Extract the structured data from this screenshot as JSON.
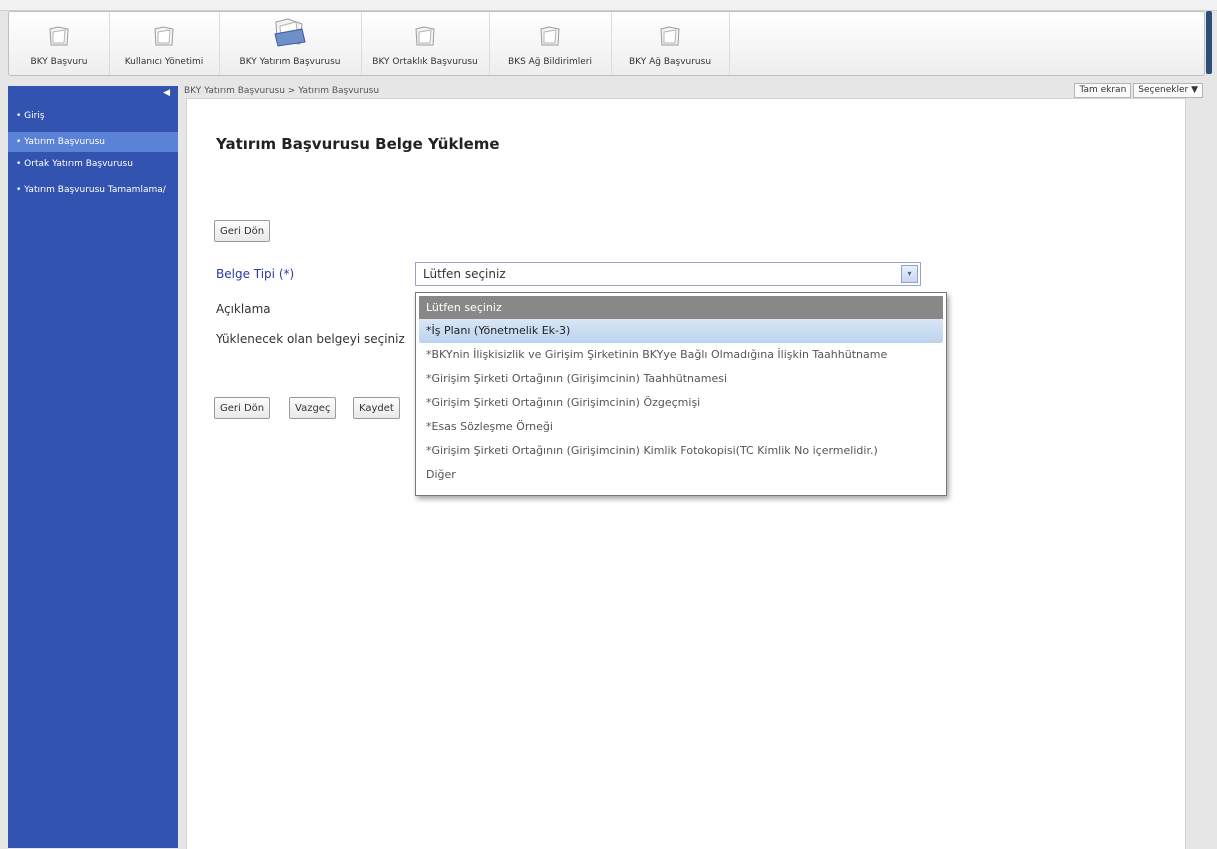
{
  "toolbar": {
    "tools": [
      {
        "label": "BKY Başvuru",
        "icon": "folder-icon"
      },
      {
        "label": "Kullanıcı Yönetimi",
        "icon": "folder-icon"
      },
      {
        "label": "BKY Yatırım Başvurusu",
        "icon": "open-folder-icon"
      },
      {
        "label": "BKY Ortaklık Başvurusu",
        "icon": "folder-icon"
      },
      {
        "label": "BKS Ağ Bildirimleri",
        "icon": "folder-icon"
      },
      {
        "label": "BKY Ağ Başvurusu",
        "icon": "folder-icon"
      }
    ],
    "active_index": 2
  },
  "sidebar": {
    "collapse_glyph": "◀",
    "items": [
      {
        "label": "• Giriş"
      },
      {
        "label": "• Yatırım Başvurusu",
        "active": true
      },
      {
        "label": "• Ortak Yatırım Başvurusu"
      },
      {
        "label": "• Yatırım Başvurusu Tamamlama/"
      }
    ]
  },
  "breadcrumb": "BKY Yatırım Başvurusu  >  Yatırım Başvurusu",
  "topbar": {
    "fullscreen": "Tam ekran",
    "options": "Seçenekler ▼"
  },
  "page": {
    "title": "Yatırım Başvurusu Belge Yükleme",
    "back_top": "Geri Dön",
    "fields": {
      "doc_type_label": "Belge Tipi (*)",
      "description_label": "Açıklama",
      "upload_label": "Yüklenecek olan belgeyi seçiniz"
    },
    "select": {
      "value": "Lütfen seçiniz",
      "arrow": "▾"
    },
    "dropdown": {
      "header": "Lütfen seçiniz",
      "options": [
        "*İş Planı (Yönetmelik Ek-3)",
        "*BKYnin İlişkisizlik ve Girişim Şirketinin BKYye Bağlı Olmadığına İlişkin Taahhütname",
        "*Girişim Şirketi Ortağının (Girişimcinin) Taahhütnamesi",
        "*Girişim Şirketi Ortağının (Girişimcinin) Özgeçmişi",
        "*Esas Sözleşme Örneği",
        "*Girişim Şirketi Ortağının (Girişimcinin) Kimlik Fotokopisi(TC Kimlik No içermelidir.)",
        "Diğer"
      ],
      "selected_index": 0
    },
    "buttons": {
      "back": "Geri Dön",
      "cancel": "Vazgeç",
      "save": "Kaydet"
    }
  },
  "colors": {
    "sidebar": "#3254b0",
    "sidebar_active": "#5a82d6",
    "required_label": "#2b39a8"
  }
}
